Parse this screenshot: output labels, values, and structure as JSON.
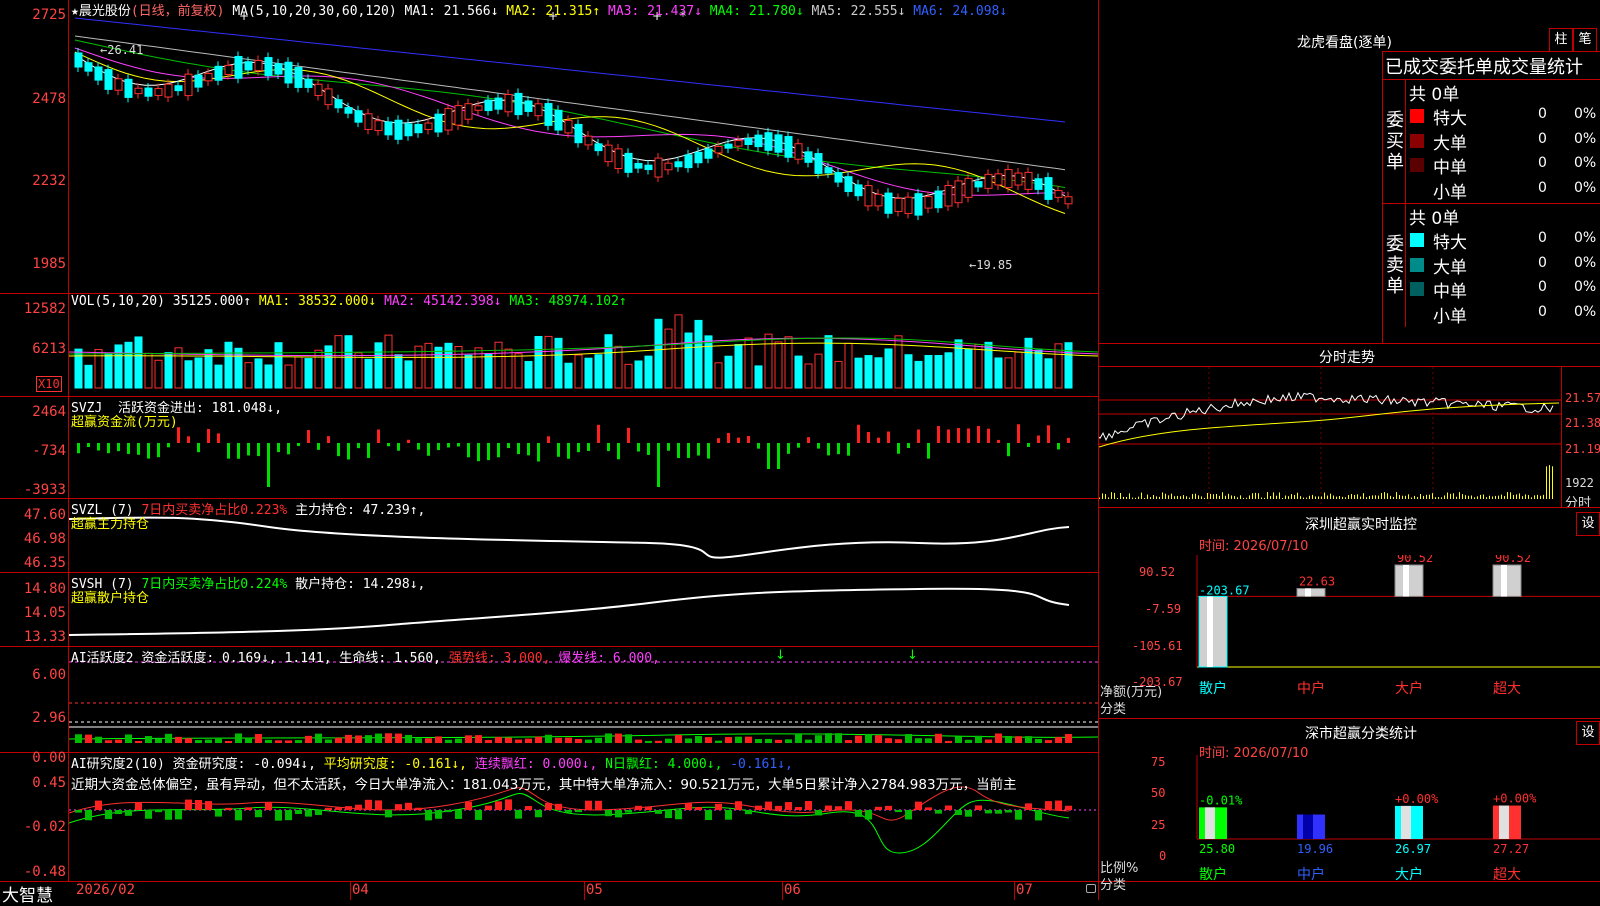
{
  "app": {
    "logo": "大智慧",
    "stock_title": "★晨光股份",
    "period": "(日线，前复权)"
  },
  "main_chart": {
    "ma_label": "MA(5,10,20,30,60,120)",
    "ma": [
      {
        "name": "MA1",
        "value": "21.566",
        "arrow": "↓",
        "color": "#ffffff"
      },
      {
        "name": "MA2",
        "value": "21.315",
        "arrow": "↑",
        "color": "#ffff00"
      },
      {
        "name": "MA3",
        "value": "21.437",
        "arrow": "↓",
        "color": "#ff40ff"
      },
      {
        "name": "MA4",
        "value": "21.780",
        "arrow": "↓",
        "color": "#00ff00"
      },
      {
        "name": "MA5",
        "value": "22.555",
        "arrow": "↓",
        "color": "#cccccc"
      },
      {
        "name": "MA6",
        "value": "24.098",
        "arrow": "↓",
        "color": "#3060ff"
      }
    ],
    "y_ticks": [
      "2725",
      "2478",
      "2232",
      "1985"
    ],
    "high_label": "←26.41",
    "low_label": "←19.85"
  },
  "vol_panel": {
    "label": "VOL(5,10,20)",
    "value": "35125.000↑",
    "ma": [
      {
        "name": "MA1",
        "value": "38532.000",
        "arrow": "↓",
        "color": "#ffff00"
      },
      {
        "name": "MA2",
        "value": "45142.398",
        "arrow": "↓",
        "color": "#ff40ff"
      },
      {
        "name": "MA3",
        "value": "48974.102",
        "arrow": "↑",
        "color": "#00ff00"
      }
    ],
    "y_ticks": [
      "12582",
      "6213"
    ],
    "unit": "X10"
  },
  "svzj_panel": {
    "label": "SVZJ",
    "item": "活跃资金进出: 181.048↓,",
    "sub": "超赢资金流(万元)",
    "y_ticks": [
      "2464",
      "-734",
      "-3933"
    ]
  },
  "svzl_panel": {
    "label": "SVZL (7)",
    "ratio": "7日内买卖净占比0.223%",
    "item": "主力持仓: 47.239↑,",
    "sub": "超赢主力持仓",
    "y_ticks": [
      "47.60",
      "46.98",
      "46.35"
    ]
  },
  "svsh_panel": {
    "label": "SVSH (7)",
    "ratio": "7日内买卖净占比0.224%",
    "item": "散户持仓: 14.298↓,",
    "sub": "超赢散户持仓",
    "y_ticks": [
      "14.80",
      "14.05",
      "13.33"
    ]
  },
  "ai_active_panel": {
    "label": "AI活跃度2",
    "item1": "资金活跃度: 0.169↓, 1.141,",
    "item2": "生命线: 1.560,",
    "item3": "强势线: 3.000,",
    "item4": "爆发线: 6.000,",
    "y_ticks": [
      "6.00",
      "2.96",
      "0.00"
    ]
  },
  "ai_research_panel": {
    "label": "AI研究度2(10)",
    "item1": "资金研究度: -0.094↓,",
    "item2": "平均研究度: -0.161↓,",
    "item3": "连续飘红: 0.000↓,",
    "item4": "N日飘红: 4.000↓,",
    "item5": "-0.161↓,",
    "text": "近期大资金总体偏空，虽有异动，但不太活跃，今日大单净流入：181.043万元，其中特大单净流入：90.521万元，大单5日累计净入2784.983万元，当前主",
    "y_ticks": [
      "0.45",
      "-0.02",
      "-0.48"
    ]
  },
  "x_axis": [
    "2026/02",
    "04",
    "05",
    "06",
    "07"
  ],
  "right_panel": {
    "lhb_title": "龙虎看盘(逐单)",
    "btn_zhu": "柱",
    "btn_bi": "笔",
    "stats_title": "已成交委托单成交量统计",
    "buy": {
      "side_label": "委买单",
      "total": "共 0单",
      "rows": [
        {
          "name": "特大",
          "count": "0",
          "pct": "0%",
          "color": "#ff0000"
        },
        {
          "name": "大单",
          "count": "0",
          "pct": "0%",
          "color": "#8b0000"
        },
        {
          "name": "中单",
          "count": "0",
          "pct": "0%",
          "color": "#5a0000"
        },
        {
          "name": "小单",
          "count": "0",
          "pct": "0%",
          "color": "#000000"
        }
      ]
    },
    "sell": {
      "side_label": "委卖单",
      "total": "共 0单",
      "rows": [
        {
          "name": "特大",
          "count": "0",
          "pct": "0%",
          "color": "#00ffff"
        },
        {
          "name": "大单",
          "count": "0",
          "pct": "0%",
          "color": "#008b8b"
        },
        {
          "name": "中单",
          "count": "0",
          "pct": "0%",
          "color": "#006060"
        },
        {
          "name": "小单",
          "count": "0",
          "pct": "0%",
          "color": "#000000"
        }
      ]
    },
    "intraday": {
      "title": "分时走势",
      "y_ticks": [
        "21.57",
        "21.38",
        "21.19"
      ],
      "vol_label": "1922",
      "footer": "分时"
    },
    "monitor": {
      "title": "深圳超赢实时监控",
      "btn": "设",
      "date": "时间: 2026/07/10",
      "y_ticks": [
        "90.52",
        "-7.59",
        "-105.61",
        "-203.67"
      ],
      "unit1": "净额(万元)",
      "unit2": "分类",
      "bars": [
        {
          "cat": "散户",
          "value": -203.67,
          "label": "-203.67"
        },
        {
          "cat": "中户",
          "value": 22.63,
          "label": "22.63"
        },
        {
          "cat": "大户",
          "value": 90.52,
          "label": "90.52"
        },
        {
          "cat": "超大",
          "value": 90.52,
          "label": "90.52"
        }
      ]
    },
    "classify": {
      "title": "深市超赢分类统计",
      "btn": "设",
      "date": "时间: 2026/07/10",
      "y_ticks": [
        "75",
        "50",
        "25",
        "0"
      ],
      "unit1": "比例%",
      "unit2": "分类",
      "bars": [
        {
          "cat": "散户",
          "value": 25.8,
          "label": "25.80",
          "delta": "-0.01%"
        },
        {
          "cat": "中户",
          "value": 19.96,
          "label": "19.96",
          "delta": ""
        },
        {
          "cat": "大户",
          "value": 26.97,
          "label": "26.97",
          "delta": "+0.00%"
        },
        {
          "cat": "超大",
          "value": 27.27,
          "label": "27.27",
          "delta": "+0.00%"
        }
      ]
    }
  }
}
